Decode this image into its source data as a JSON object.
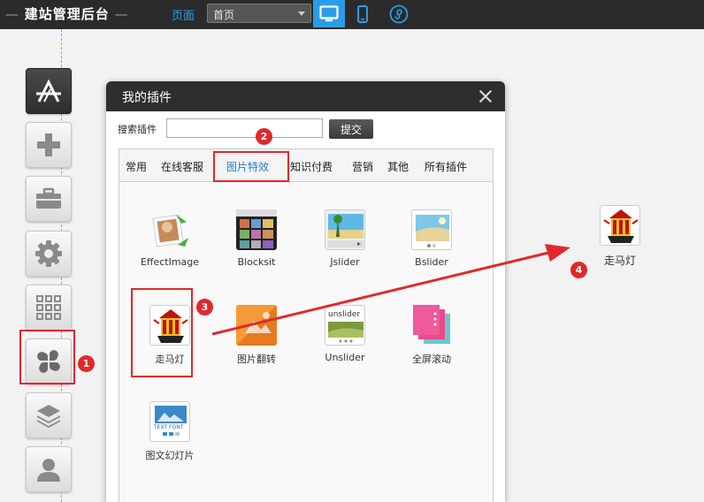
{
  "topbar": {
    "title": "建站管理后台",
    "page_label": "页面",
    "page_select_value": "首页",
    "devices": [
      "desktop-icon",
      "mobile-icon",
      "mini-program-icon"
    ]
  },
  "sidebar": {
    "items": [
      "app-store-icon",
      "plus-icon",
      "toolbox-icon",
      "gear-icon",
      "grid-icon",
      "plugin-clover-icon",
      "layers-icon",
      "user-icon"
    ],
    "active_index": 5
  },
  "dialog": {
    "title": "我的插件",
    "search_label": "搜索插件",
    "search_value": "",
    "submit_label": "提交",
    "tabs": [
      "常用",
      "在线客服",
      "图片特效",
      "知识付费",
      "营销",
      "其他",
      "所有插件"
    ],
    "active_tab": "图片特效",
    "plugins": [
      {
        "name": "EffectImage"
      },
      {
        "name": "Blocksit"
      },
      {
        "name": "Jslider"
      },
      {
        "name": "Bslider"
      },
      {
        "name": "走马灯"
      },
      {
        "name": "图片翻转"
      },
      {
        "name": "Unslider"
      },
      {
        "name": "全屏滚动"
      },
      {
        "name": "图文幻灯片"
      }
    ],
    "unslider_icon_text": "unslider",
    "textfont_icon_text": "TEXT FONT"
  },
  "dropped_plugin": {
    "name": "走马灯"
  },
  "annotations": [
    "1",
    "2",
    "3",
    "4"
  ],
  "colors": {
    "accent": "#2a9de8",
    "annotation_red": "#e0282c",
    "topbar_bg": "#2b2b2b"
  }
}
